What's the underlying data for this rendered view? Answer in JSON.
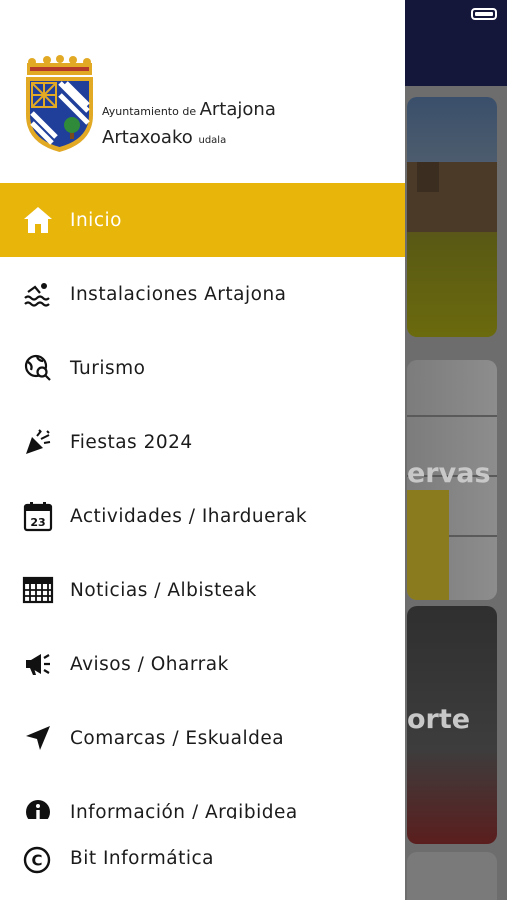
{
  "org": {
    "prefix": "Ayuntamiento de",
    "name": "Artajona",
    "name_basque": "Artaxoako",
    "suffix_basque": "udala"
  },
  "menu": {
    "items": [
      {
        "label": "Inicio",
        "icon": "home-icon",
        "active": true
      },
      {
        "label": "Instalaciones Artajona",
        "icon": "swimming-icon"
      },
      {
        "label": "Turismo",
        "icon": "globe-search-icon"
      },
      {
        "label": "Fiestas 2024",
        "icon": "party-popper-icon"
      },
      {
        "label": "Actividades / Iharduerak",
        "icon": "calendar-icon",
        "day": "23"
      },
      {
        "label": "Noticias / Albisteak",
        "icon": "newspaper-icon"
      },
      {
        "label": "Avisos / Oharrak",
        "icon": "megaphone-icon"
      },
      {
        "label": "Comarcas / Eskualdea",
        "icon": "navigation-arrow-icon"
      },
      {
        "label": "Información / Argibidea",
        "icon": "info-icon"
      }
    ],
    "footer": {
      "label": "Bit Informática",
      "icon": "copyright-icon"
    }
  },
  "background": {
    "card_labels": [
      "ervas",
      "orte"
    ]
  },
  "colors": {
    "active": "#e8b50a",
    "header": "#14163a"
  }
}
